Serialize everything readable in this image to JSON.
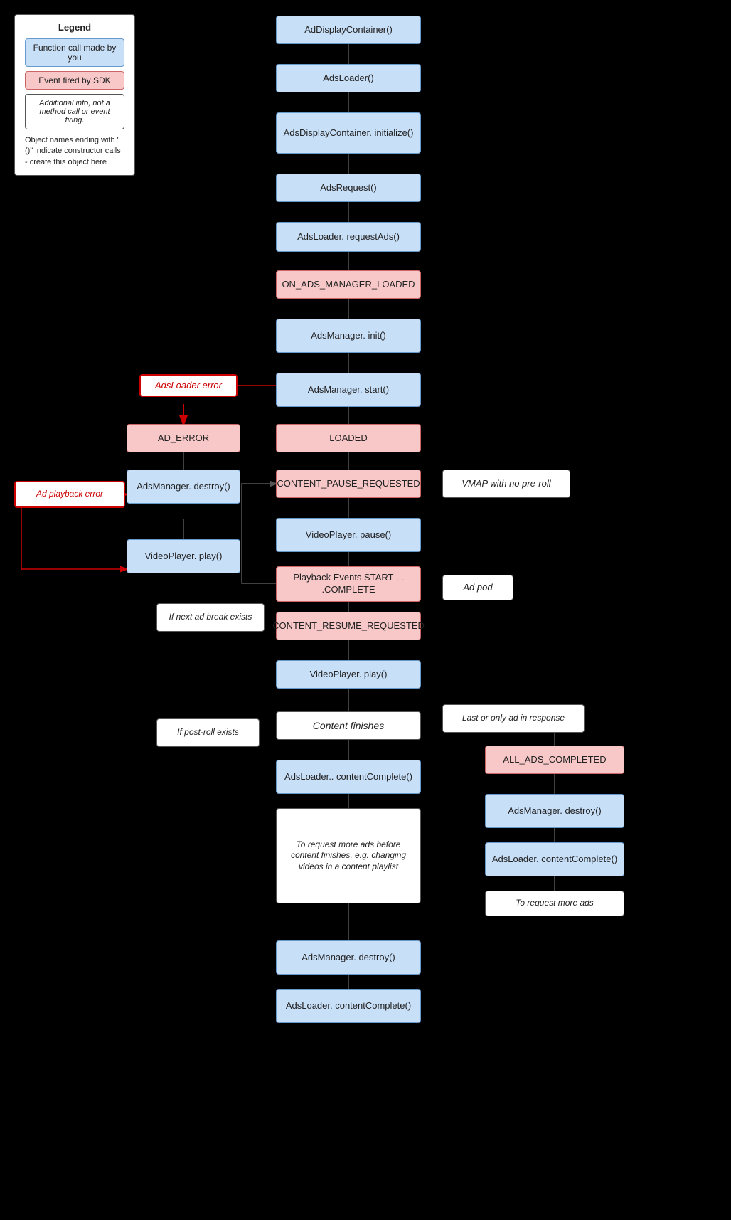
{
  "legend": {
    "title": "Legend",
    "box1": "Function call made by you",
    "box2": "Event fired by SDK",
    "box3": "Additional info, not a method call or event firing.",
    "note": "Object names ending with \"()\" indicate constructor calls - create this object here"
  },
  "nodes": {
    "adDisplayContainer": "AdDisplayContainer()",
    "adsLoader": "AdsLoader()",
    "adsDisplayContainerInit": "AdsDisplayContainer.\ninitialize()",
    "adsRequest": "AdsRequest()",
    "adsLoaderRequestAds": "AdsLoader.\nrequestAds()",
    "onAdsManagerLoaded": "ON_ADS_MANAGER_LOADED",
    "adsManagerInit": "AdsManager.\ninit()",
    "adsLoaderError": "AdsLoader error",
    "adsManagerStart": "AdsManager.\nstart()",
    "adError": "AD_ERROR",
    "loaded": "LOADED",
    "adPlaybackError": "Ad playback error",
    "adsManagerDestroy1": "AdsManager.\ndestroy()",
    "contentPauseRequested": "CONTENT_PAUSE_REQUESTED",
    "vmapNoPre": "VMAP with no pre-roll",
    "videoPlayerPlay1": "VideoPlayer.\nplay()",
    "videoPlayerPause": "VideoPlayer.\npause()",
    "playbackEvents": "Playback Events\nSTART . . .COMPLETE",
    "adPod": "Ad pod",
    "ifNextAdBreak": "If next ad break exists",
    "contentResumeRequested": "CONTENT_RESUME_REQUESTED",
    "videoPlayerPlay2": "VideoPlayer.\nplay()",
    "lastOrOnly": "Last or only ad in response",
    "ifPostRoll": "If post-roll exists",
    "contentFinishes": "Content finishes",
    "allAdsCompleted": "ALL_ADS_COMPLETED",
    "adsLoaderContentComplete1": "AdsLoader..\ncontentComplete()",
    "adsManagerDestroy2": "AdsManager.\ndestroy()",
    "adsLoaderContentComplete2": "AdsLoader.\ncontentComplete()",
    "toRequestMoreAds": "To request more ads",
    "toRequestMoreAdsNote": "To request more ads before content finishes, e.g. changing videos in a content playlist",
    "adsManagerDestroy3": "AdsManager.\ndestroy()",
    "adsLoaderContentComplete3": "AdsLoader.\ncontentComplete()"
  }
}
